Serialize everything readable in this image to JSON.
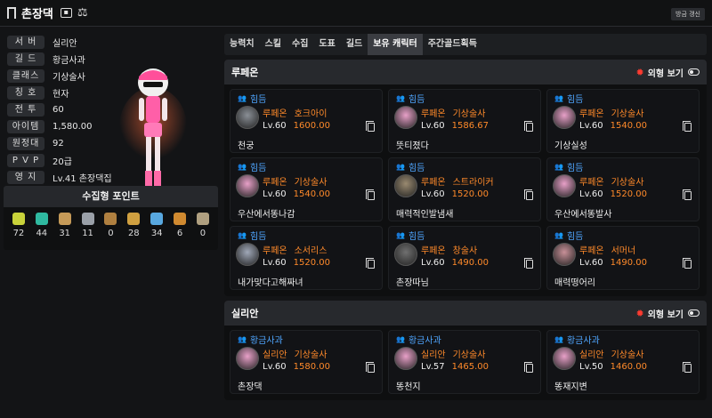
{
  "header": {
    "title": "촌장댁",
    "refresh": "방금 갱신"
  },
  "info": [
    {
      "label": "서 버",
      "value": "실리안"
    },
    {
      "label": "길 드",
      "value": "황금사과"
    },
    {
      "label": "클래스",
      "value": "기상술사"
    },
    {
      "label": "칭 호",
      "value": "현자"
    },
    {
      "label": "전 투",
      "value": "60"
    },
    {
      "label": "아이템",
      "value": "1,580.00"
    },
    {
      "label": "원정대",
      "value": "92"
    },
    {
      "label": "P V P",
      "value": "20급"
    },
    {
      "label": "영 지",
      "value": "Lv.41 촌장댁집"
    }
  ],
  "points": {
    "title": "수집형 포인트",
    "items": [
      {
        "icon": "seed-icon",
        "value": "72",
        "color": "#c8d23a"
      },
      {
        "icon": "island-heart-icon",
        "value": "44",
        "color": "#2fb9a0"
      },
      {
        "icon": "art-icon",
        "value": "31",
        "color": "#c59a58"
      },
      {
        "icon": "mokoko-icon",
        "value": "11",
        "color": "#9aa0a8"
      },
      {
        "icon": "monster-icon",
        "value": "0",
        "color": "#b08040"
      },
      {
        "icon": "sword-icon",
        "value": "28",
        "color": "#d0a040"
      },
      {
        "icon": "star-icon",
        "value": "34",
        "color": "#58a8e0"
      },
      {
        "icon": "voyage-icon",
        "value": "6",
        "color": "#d08a30"
      },
      {
        "icon": "orb-icon",
        "value": "0",
        "color": "#b0a080"
      }
    ]
  },
  "tabs": [
    "능력치",
    "스킬",
    "수집",
    "도표",
    "길드",
    "보유 캐릭터",
    "주간골드획득"
  ],
  "look_label": "외형 보기",
  "servers": [
    {
      "name": "루페온",
      "chars": [
        {
          "guild": "힘듬",
          "server": "루페온",
          "cls": "호크아이",
          "level": "Lv.60",
          "ilvl": "1600.00",
          "name": "천궁",
          "tone": "#8a8f96"
        },
        {
          "guild": "힘듬",
          "server": "루페온",
          "cls": "기상술사",
          "level": "Lv.60",
          "ilvl": "1586.67",
          "name": "뜻티졌다",
          "tone": "#e8a0c8"
        },
        {
          "guild": "힘듬",
          "server": "루페온",
          "cls": "기상술사",
          "level": "Lv.60",
          "ilvl": "1540.00",
          "name": "기상실성",
          "tone": "#e8a0c8"
        },
        {
          "guild": "힘듬",
          "server": "루페온",
          "cls": "기상술사",
          "level": "Lv.60",
          "ilvl": "1540.00",
          "name": "우산에서똥나감",
          "tone": "#e8a0c8"
        },
        {
          "guild": "힘듬",
          "server": "루페온",
          "cls": "스트라이커",
          "level": "Lv.60",
          "ilvl": "1520.00",
          "name": "매력적인발냄새",
          "tone": "#9a8a70"
        },
        {
          "guild": "힘듬",
          "server": "루페온",
          "cls": "기상술사",
          "level": "Lv.60",
          "ilvl": "1520.00",
          "name": "우산에서똥발사",
          "tone": "#e8a0c8"
        },
        {
          "guild": "힘듬",
          "server": "루페온",
          "cls": "소서리스",
          "level": "Lv.60",
          "ilvl": "1520.00",
          "name": "내가맞다고해짜녀",
          "tone": "#a0a8b8"
        },
        {
          "guild": "힘듬",
          "server": "루페온",
          "cls": "창술사",
          "level": "Lv.60",
          "ilvl": "1490.00",
          "name": "촌장따님",
          "tone": "#707070"
        },
        {
          "guild": "힘듬",
          "server": "루페온",
          "cls": "서머너",
          "level": "Lv.60",
          "ilvl": "1490.00",
          "name": "매력떵어리",
          "tone": "#c89098"
        }
      ]
    },
    {
      "name": "실리안",
      "chars": [
        {
          "guild": "황금사과",
          "server": "실리안",
          "cls": "기상술사",
          "level": "Lv.60",
          "ilvl": "1580.00",
          "name": "촌장댁",
          "tone": "#e8a0c8"
        },
        {
          "guild": "황금사과",
          "server": "실리안",
          "cls": "기상술사",
          "level": "Lv.57",
          "ilvl": "1465.00",
          "name": "똥천지",
          "tone": "#e8a0c8"
        },
        {
          "guild": "황금사과",
          "server": "실리안",
          "cls": "기상술사",
          "level": "Lv.50",
          "ilvl": "1460.00",
          "name": "똥재지변",
          "tone": "#e8a0c8"
        }
      ]
    }
  ]
}
